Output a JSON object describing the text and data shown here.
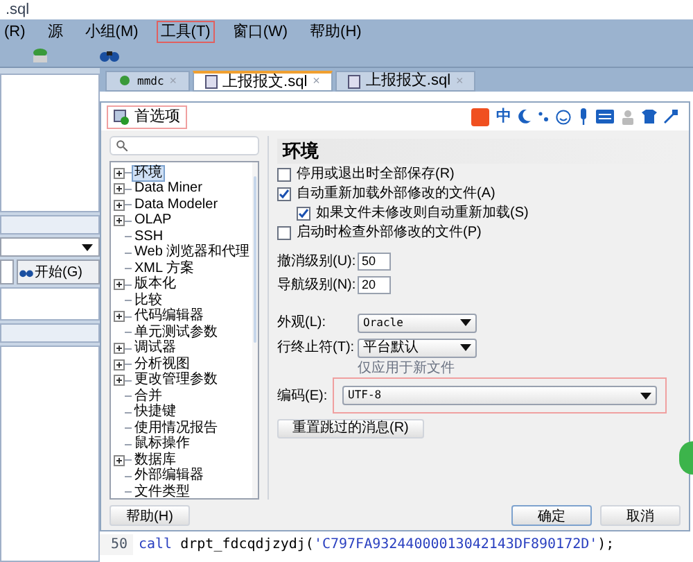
{
  "window": {
    "title": ".sql"
  },
  "menu": [
    {
      "label": "(R)",
      "selected": false
    },
    {
      "label": "源",
      "selected": false
    },
    {
      "label": "小组(M)",
      "selected": false
    },
    {
      "label": "工具(T)",
      "selected": true
    },
    {
      "label": "窗口(W)",
      "selected": false
    },
    {
      "label": "帮助(H)",
      "selected": false
    }
  ],
  "editor_tabs": [
    {
      "label": "mmdc",
      "selected": false,
      "close": "×"
    },
    {
      "label": "上报报文.sql",
      "selected": true,
      "close": "×"
    },
    {
      "label": "上报报文.sql",
      "selected": false,
      "close": "×"
    }
  ],
  "left_panel": {
    "search_button": "开始(G)"
  },
  "code": [
    {
      "line": "50",
      "keyword": "call",
      "text": " drpt_fdcqdjzydj(",
      "string": "'C797FA93244000013042143DF890172D'",
      "end": ");"
    }
  ],
  "dialog": {
    "title": "首选项",
    "ime": "中",
    "tree": [
      {
        "label": "环境",
        "expandable": true,
        "selected": true
      },
      {
        "label": "Data Miner",
        "expandable": true,
        "selected": false
      },
      {
        "label": "Data Modeler",
        "expandable": true,
        "selected": false
      },
      {
        "label": "OLAP",
        "expandable": true,
        "selected": false
      },
      {
        "label": "SSH",
        "expandable": false,
        "selected": false
      },
      {
        "label": "Web 浏览器和代理",
        "expandable": false,
        "selected": false
      },
      {
        "label": "XML 方案",
        "expandable": false,
        "selected": false
      },
      {
        "label": "版本化",
        "expandable": true,
        "selected": false
      },
      {
        "label": "比较",
        "expandable": false,
        "selected": false
      },
      {
        "label": "代码编辑器",
        "expandable": true,
        "selected": false
      },
      {
        "label": "单元测试参数",
        "expandable": false,
        "selected": false
      },
      {
        "label": "调试器",
        "expandable": true,
        "selected": false
      },
      {
        "label": "分析视图",
        "expandable": true,
        "selected": false
      },
      {
        "label": "更改管理参数",
        "expandable": true,
        "selected": false
      },
      {
        "label": "合并",
        "expandable": false,
        "selected": false
      },
      {
        "label": "快捷键",
        "expandable": false,
        "selected": false
      },
      {
        "label": "使用情况报告",
        "expandable": false,
        "selected": false
      },
      {
        "label": "鼠标操作",
        "expandable": false,
        "selected": false
      },
      {
        "label": "数据库",
        "expandable": true,
        "selected": false
      },
      {
        "label": "外部编辑器",
        "expandable": false,
        "selected": false
      },
      {
        "label": "文件类型",
        "expandable": false,
        "selected": false
      }
    ],
    "heading": "环境",
    "checkboxes": [
      {
        "label": "停用或退出时全部保存(R)",
        "checked": false,
        "indented": false
      },
      {
        "label": "自动重新加载外部修改的文件(A)",
        "checked": true,
        "indented": false
      },
      {
        "label": "如果文件未修改则自动重新加载(S)",
        "checked": true,
        "indented": true
      },
      {
        "label": "启动时检查外部修改的文件(P)",
        "checked": false,
        "indented": false
      }
    ],
    "fields": [
      {
        "label": "撤消级别(U):",
        "value": "50"
      },
      {
        "label": "导航级别(N):",
        "value": "20"
      }
    ],
    "selects": [
      {
        "label": "外观(L):",
        "value": "Oracle"
      },
      {
        "label": "行终止符(T):",
        "value": "平台默认"
      }
    ],
    "encoding": {
      "hint": "仅应用于新文件",
      "label": "编码(E):",
      "value": "UTF-8",
      "highlighted": true
    },
    "reset_button": "重置跳过的消息(R)",
    "buttons": {
      "help": "帮助(H)",
      "ok": "确定",
      "cancel": "取消"
    }
  }
}
